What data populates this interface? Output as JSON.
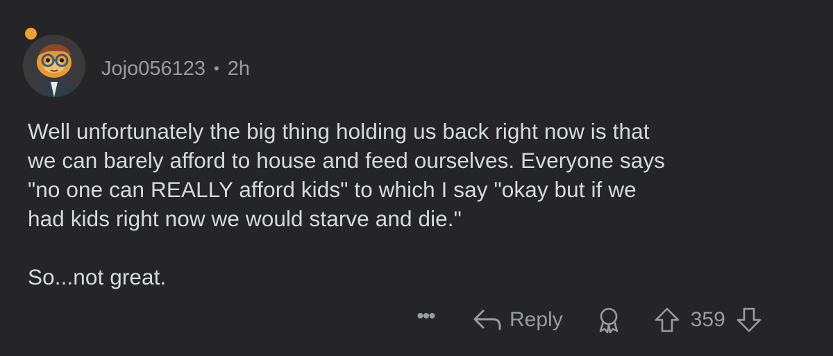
{
  "comment": {
    "username": "Jojo056123",
    "separator": "•",
    "time": "2h",
    "paragraphs": [
      "Well unfortunately the big thing holding us back right now is that\nwe can barely afford to house and feed ourselves. Everyone says\n\"no one can REALLY afford kids\" to which I say \"okay but if we\nhad kids right now we would starve and die.\"",
      "So...not great."
    ]
  },
  "actions": {
    "more_label": "•••",
    "reply_label": "Reply",
    "score": "359"
  },
  "colors": {
    "background": "#252528",
    "text": "#d7dadc",
    "muted": "#9a9ca0",
    "online": "#f0a030"
  },
  "icons": [
    "avatar",
    "more-options-icon",
    "reply-arrow-icon",
    "award-icon",
    "upvote-icon",
    "downvote-icon"
  ]
}
